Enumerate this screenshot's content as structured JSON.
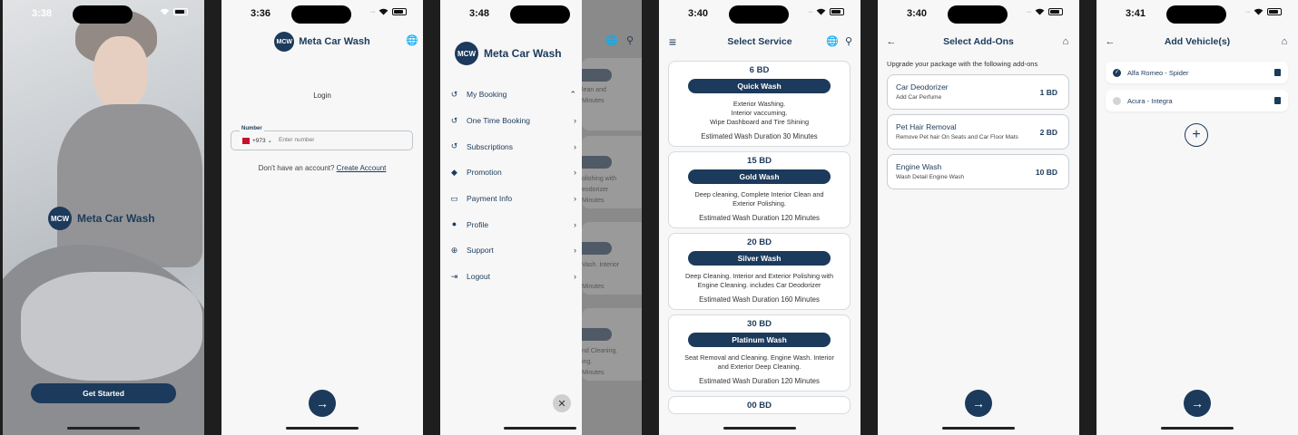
{
  "brand": {
    "logo_text": "MCW",
    "name": "Meta Car Wash"
  },
  "colors": {
    "primary": "#1c3a5b",
    "background": "#f7f7f7"
  },
  "screens": {
    "splash": {
      "time": "3:38",
      "cta": "Get Started"
    },
    "login": {
      "time": "3:36",
      "heading": "Login",
      "field_label": "Number",
      "country_code": "+973",
      "phone_placeholder": "Enter number",
      "no_account": "Don't have an account?",
      "create_account": "Create Account"
    },
    "menu": {
      "time": "3:48",
      "items": [
        {
          "label": "My Booking",
          "icon": "history-icon",
          "chevron": "⌃"
        },
        {
          "label": "One Time Booking",
          "icon": "history-icon",
          "chevron": "›"
        },
        {
          "label": "Subscriptions",
          "icon": "history-icon",
          "chevron": "›"
        },
        {
          "label": "Promotion",
          "icon": "tag-icon",
          "chevron": "›"
        },
        {
          "label": "Payment Info",
          "icon": "card-icon",
          "chevron": "›"
        },
        {
          "label": "Profile",
          "icon": "person-icon",
          "chevron": "›"
        },
        {
          "label": "Support",
          "icon": "lifebuoy-icon",
          "chevron": "›"
        },
        {
          "label": "Logout",
          "icon": "logout-icon",
          "chevron": "›"
        }
      ],
      "background_fragments": [
        "lean and\nMinutes",
        "olishing with\neodorizer\nMinutes",
        "Vash. Interior\n\nMinutes",
        "nd Cleaning.\ning.\nMinutes"
      ]
    },
    "select_service": {
      "time": "3:40",
      "title": "Select Service",
      "services": [
        {
          "price": "6 BD",
          "name": "Quick Wash",
          "description": "Exterior Washing.\nInterior vaccuming.\nWipe Dashboard and Tire Shining",
          "duration": "Estimated Wash Duration 30 Minutes"
        },
        {
          "price": "15 BD",
          "name": "Gold Wash",
          "description": "Deep cleaning, Complete Interior Clean and\nExterior Polishing.",
          "duration": "Estimated Wash Duration 120 Minutes"
        },
        {
          "price": "20 BD",
          "name": "Silver Wash",
          "description": "Deep Cleaning. Interior and Exterior Polishing with\nEngine Cleaning. includes Car Deodorizer",
          "duration": "Estimated Wash Duration 160 Minutes"
        },
        {
          "price": "30 BD",
          "name": "Platinum Wash",
          "description": "Seat Removal and Cleaning. Engine Wash. Interior\nand Exterior Deep Cleaning.",
          "duration": "Estimated Wash Duration 120 Minutes"
        },
        {
          "price": "00 BD",
          "name": "",
          "description": "",
          "duration": ""
        }
      ]
    },
    "add_ons": {
      "time": "3:40",
      "title": "Select Add-Ons",
      "subtitle": "Upgrade your package with the following add-ons",
      "items": [
        {
          "name": "Car Deodorizer",
          "description": "Add Car Perfume",
          "price": "1 BD"
        },
        {
          "name": "Pet Hair Removal",
          "description": "Remove Pet hair On Seats and Car Floor Mats",
          "price": "2 BD"
        },
        {
          "name": "Engine Wash",
          "description": "Wash Detail Engine Wash",
          "price": "10 BD"
        }
      ]
    },
    "vehicles": {
      "time": "3:41",
      "title": "Add Vehicle(s)",
      "items": [
        {
          "name": "Alfa Romeo - Spider",
          "selected": true
        },
        {
          "name": "Acura - Integra",
          "selected": false
        }
      ]
    }
  },
  "icons": {
    "next": "→",
    "back": "←",
    "close": "✕",
    "globe": "🌐",
    "pin": "⚲",
    "menu": "≡",
    "plus": "+"
  }
}
